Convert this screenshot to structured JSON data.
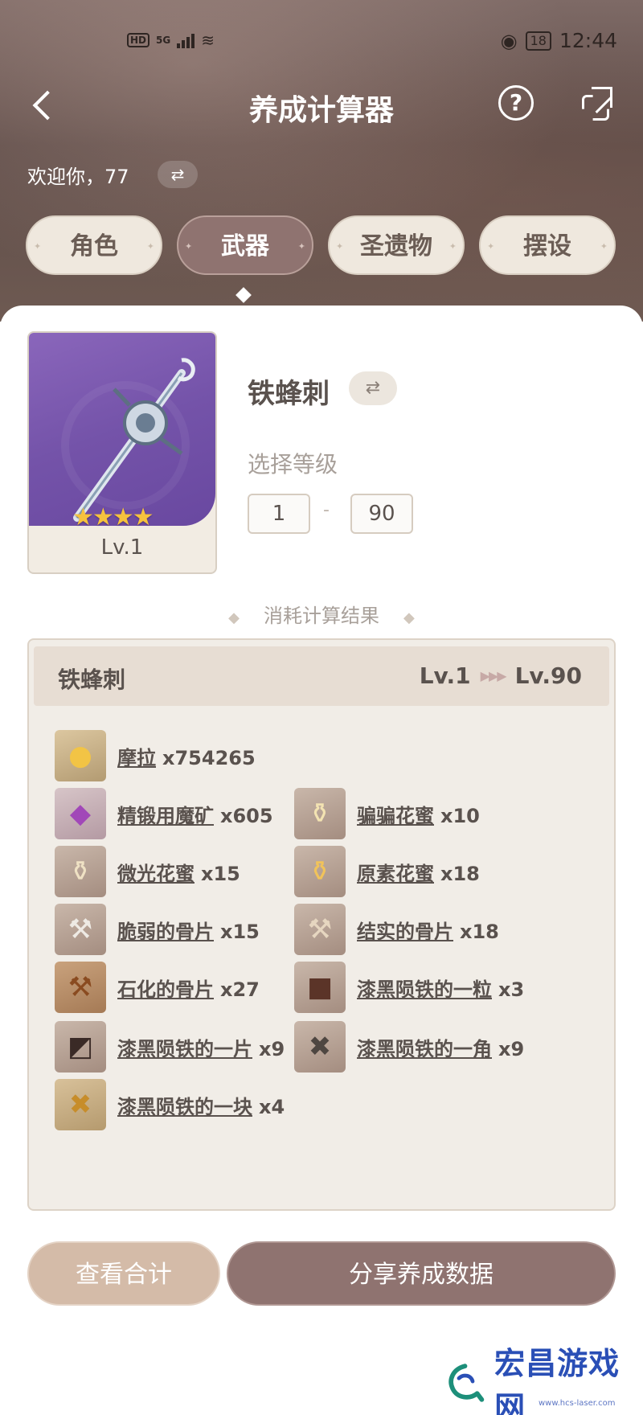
{
  "status_bar": {
    "network_badge": "HD",
    "network_type": "5G",
    "battery": "18",
    "time": "12:44"
  },
  "header": {
    "title": "养成计算器",
    "back_icon": "chevron-left-icon",
    "help_label": "?",
    "share_icon": "share-icon"
  },
  "welcome": {
    "text": "欢迎你，77",
    "swap_glyph": "⇄"
  },
  "tabs": [
    {
      "label": "角色",
      "active": false
    },
    {
      "label": "武器",
      "active": true
    },
    {
      "label": "圣遗物",
      "active": false
    },
    {
      "label": "摆设",
      "active": false
    }
  ],
  "weapon": {
    "name": "铁蜂刺",
    "level_badge": "Lv.1",
    "rarity_stars": "★★★★",
    "swap_glyph": "⇄",
    "select_level_label": "选择等级",
    "level_from": "1",
    "level_dash": "-",
    "level_to": "90"
  },
  "result": {
    "section_title": "消耗计算结果",
    "diamond": "◆",
    "weapon_name": "铁蜂刺",
    "from_level": "Lv.1",
    "arrows": "▶▶▶",
    "to_level": "Lv.90",
    "materials": [
      {
        "name": "摩拉",
        "count": "x754265",
        "icon": "mora-coin-icon"
      },
      {
        "name": "精锻用魔矿",
        "count": "x605",
        "icon": "mystic-ore-icon"
      },
      {
        "name": "骗骗花蜜",
        "count": "x10",
        "icon": "nectar-bottle-icon"
      },
      {
        "name": "微光花蜜",
        "count": "x15",
        "icon": "shimmering-nectar-icon"
      },
      {
        "name": "原素花蜜",
        "count": "x18",
        "icon": "energy-nectar-icon"
      },
      {
        "name": "脆弱的骨片",
        "count": "x15",
        "icon": "fragile-bone-icon"
      },
      {
        "name": "结实的骨片",
        "count": "x18",
        "icon": "sturdy-bone-icon"
      },
      {
        "name": "石化的骨片",
        "count": "x27",
        "icon": "fossilized-bone-icon"
      },
      {
        "name": "漆黑陨铁的一粒",
        "count": "x3",
        "icon": "meteorite-grain-icon"
      },
      {
        "name": "漆黑陨铁的一片",
        "count": "x9",
        "icon": "meteorite-piece-icon"
      },
      {
        "name": "漆黑陨铁的一角",
        "count": "x9",
        "icon": "meteorite-chunk-icon"
      },
      {
        "name": "漆黑陨铁的一块",
        "count": "x4",
        "icon": "meteorite-block-icon"
      }
    ]
  },
  "actions": {
    "view_total": "查看合计",
    "share_data": "分享养成数据"
  },
  "watermark": {
    "brand": "宏昌游戏网",
    "site": "www.hcs-laser.com"
  }
}
